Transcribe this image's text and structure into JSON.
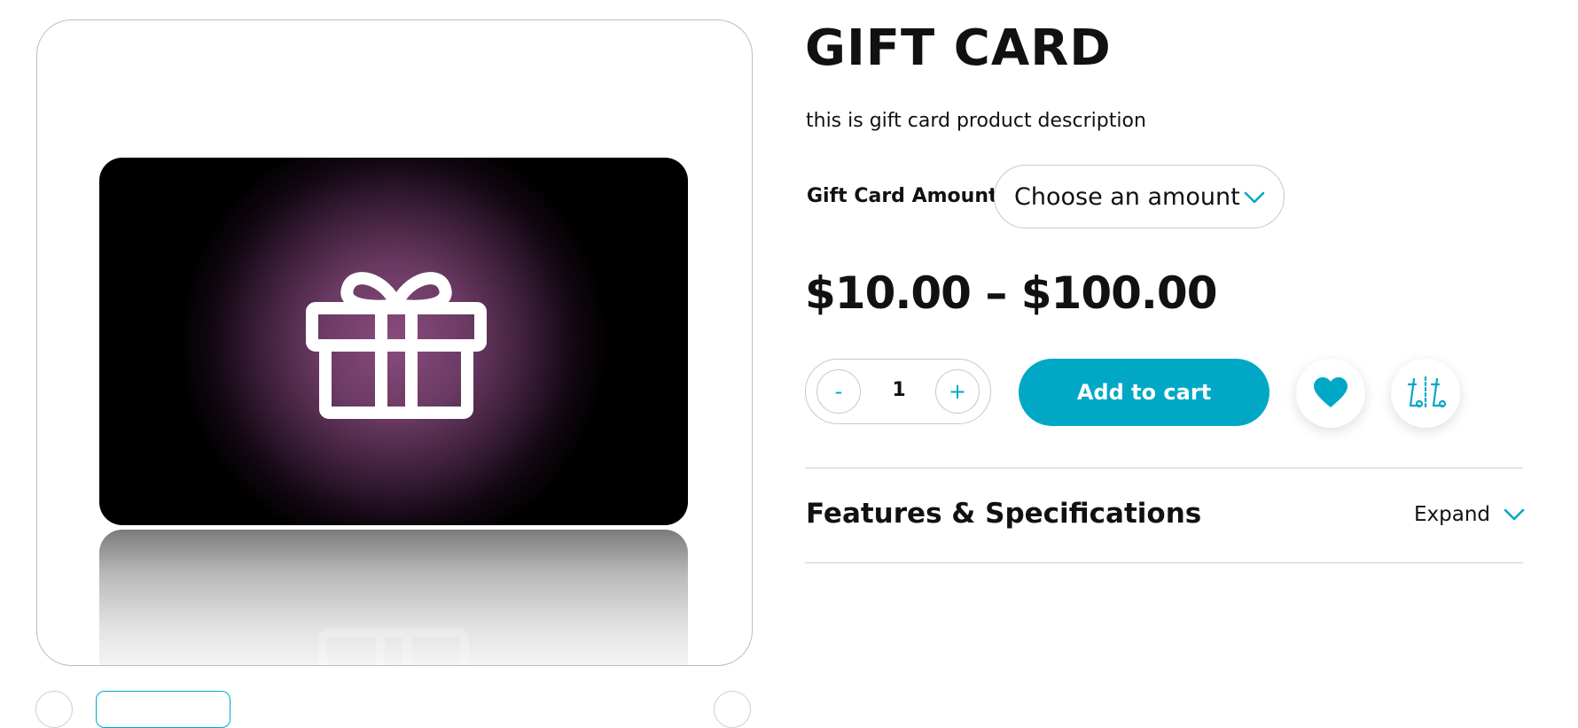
{
  "product": {
    "title": "GIFT CARD",
    "description": "this is gift card product description",
    "price_range": "$10.00 – $100.00"
  },
  "variation": {
    "label": "Gift Card Amount",
    "selected": "Choose an amount"
  },
  "quantity": {
    "minus_label": "-",
    "value": "1",
    "plus_label": "+"
  },
  "actions": {
    "add_to_cart": "Add to cart",
    "wishlist_icon": "heart-icon",
    "compare_icon": "compare-icon"
  },
  "features": {
    "title": "Features & Specifications",
    "expand_label": "Expand"
  },
  "colors": {
    "accent": "#00a8c6",
    "text": "#111111",
    "border": "#c8c8c8"
  }
}
